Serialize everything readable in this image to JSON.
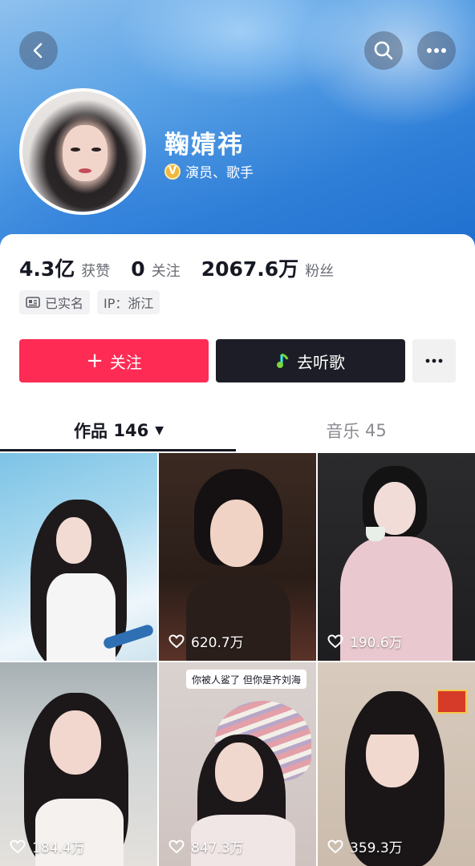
{
  "header": {
    "back_icon": "chevron-left-icon",
    "search_icon": "search-icon",
    "more_icon": "more-horizontal-icon"
  },
  "profile": {
    "name": "鞠婧祎",
    "verify_badge": "V",
    "verify_text": "演员、歌手"
  },
  "stats": [
    {
      "value": "4.3亿",
      "label": "获赞"
    },
    {
      "value": "0",
      "label": "关注"
    },
    {
      "value": "2067.6万",
      "label": "粉丝"
    }
  ],
  "tags": {
    "realname": "已实名",
    "ip": "IP：浙江"
  },
  "actions": {
    "follow_plus": "+",
    "follow_label": "关注",
    "listen_label": "去听歌",
    "follow_color": "#fe2c55",
    "listen_color": "#1c1d26"
  },
  "tabs": {
    "works_label": "作品",
    "works_count": "146",
    "works_caret": "▼",
    "music_label": "音乐",
    "music_count": "45"
  },
  "videos": [
    {
      "likes": ""
    },
    {
      "likes": "620.7万"
    },
    {
      "likes": "190.6万"
    },
    {
      "likes": "184.4万"
    },
    {
      "likes": "847.3万",
      "caption": "你被人鲨了 但你是齐刘海"
    },
    {
      "likes": "359.3万"
    }
  ]
}
